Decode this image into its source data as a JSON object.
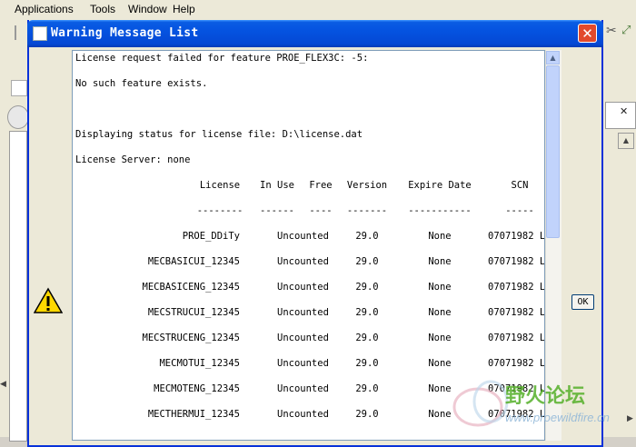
{
  "app": {
    "menu": [
      "Applications",
      "Tools",
      "Window",
      "Help"
    ]
  },
  "dialog": {
    "title": "Warning Message List",
    "close_label": "✕",
    "ok_label": "OK",
    "messages": [
      "License request failed for feature PROE_FLEX3C: -5:",
      "No such feature exists.",
      "Displaying status for license file: D:\\license.dat",
      "License Server: none"
    ],
    "table": {
      "headers": [
        "License",
        "In Use",
        "Free",
        "Version",
        "Expire Date",
        "SCN"
      ],
      "separators": [
        "--------",
        "------",
        "----",
        "-------",
        "-----------",
        "-----"
      ],
      "rows": [
        {
          "license": "PROE_DDiTy",
          "in_use": "Uncounted",
          "version": "29.0",
          "expire": "None",
          "scn": "07071982 L"
        },
        {
          "license": "MECBASICUI_12345",
          "in_use": "Uncounted",
          "version": "29.0",
          "expire": "None",
          "scn": "07071982 L"
        },
        {
          "license": "MECBASICENG_12345",
          "in_use": "Uncounted",
          "version": "29.0",
          "expire": "None",
          "scn": "07071982 L"
        },
        {
          "license": "MECSTRUCUI_12345",
          "in_use": "Uncounted",
          "version": "29.0",
          "expire": "None",
          "scn": "07071982 L"
        },
        {
          "license": "MECSTRUCENG_12345",
          "in_use": "Uncounted",
          "version": "29.0",
          "expire": "None",
          "scn": "07071982 L"
        },
        {
          "license": "MECMOTUI_12345",
          "in_use": "Uncounted",
          "version": "29.0",
          "expire": "None",
          "scn": "07071982 L"
        },
        {
          "license": "MECMOTENG_12345",
          "in_use": "Uncounted",
          "version": "29.0",
          "expire": "None",
          "scn": "07071982 L"
        },
        {
          "license": "MECTHERMUI_12345",
          "in_use": "Uncounted",
          "version": "29.0",
          "expire": "None",
          "scn": "07071982 L"
        }
      ]
    }
  },
  "watermark": {
    "title": "野火论坛",
    "url": "www.proewildfire.cn"
  },
  "colors": {
    "titlebar": "#0553e0",
    "close": "#e24a2c",
    "dialog_bg": "#ece9d8"
  }
}
